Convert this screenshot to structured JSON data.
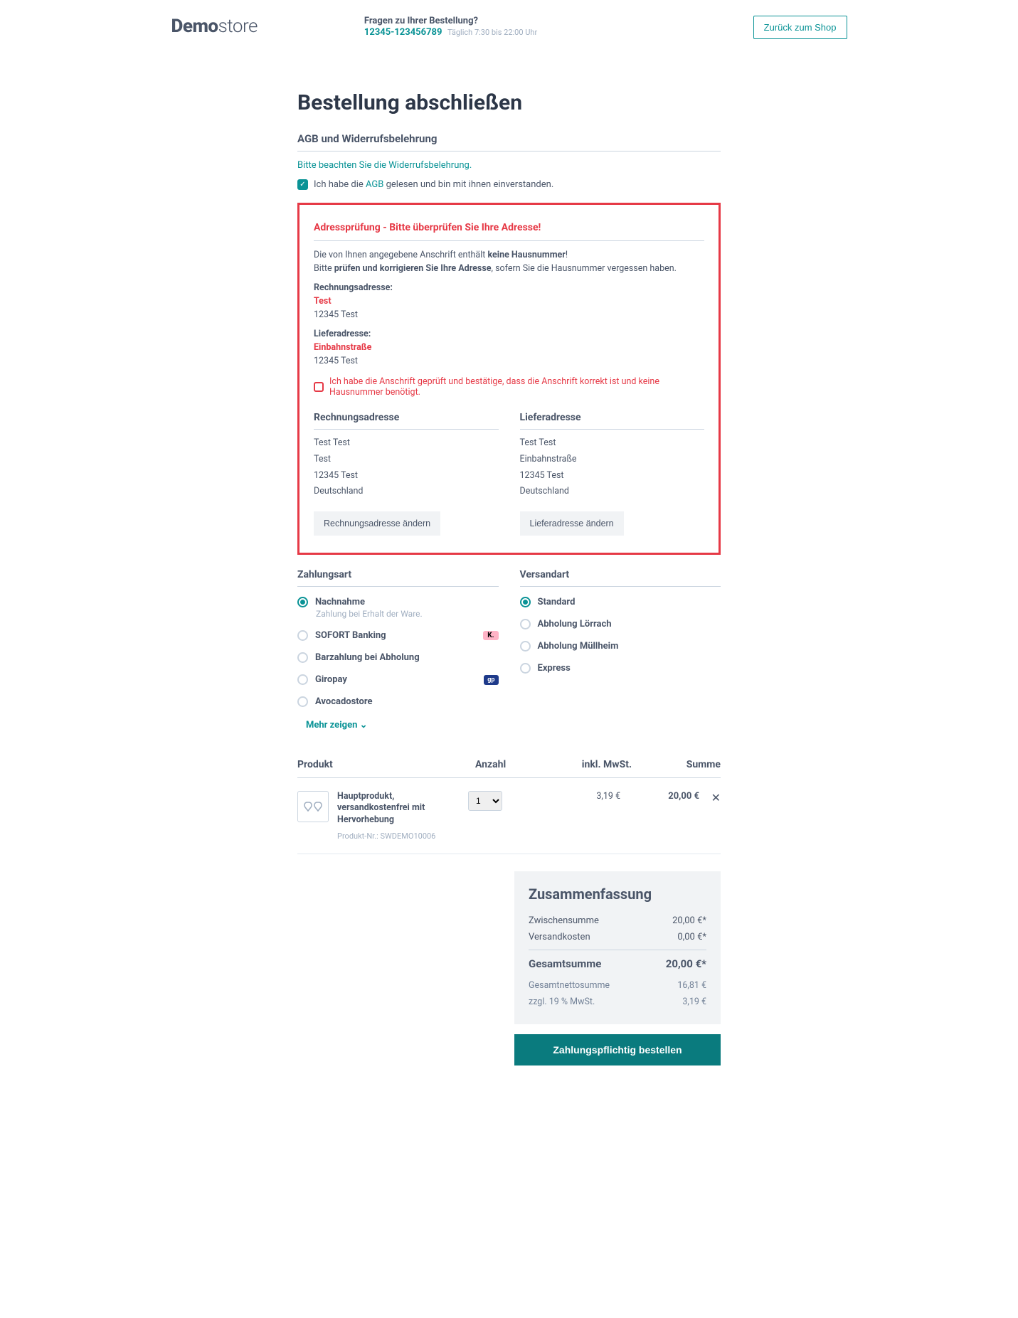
{
  "header": {
    "logo_bold": "Demo",
    "logo_light": "store",
    "question": "Fragen zu Ihrer Bestellung?",
    "phone": "12345-123456789",
    "hours": "Täglich 7:30 bis 22:00 Uhr",
    "back": "Zurück zum Shop"
  },
  "title": "Bestellung abschließen",
  "terms": {
    "heading": "AGB und Widerrufsbelehrung",
    "notice": "Bitte beachten Sie die Widerrufsbelehrung.",
    "accept_pre": "Ich habe die ",
    "accept_link": "AGB",
    "accept_post": " gelesen und bin mit ihnen einverstanden."
  },
  "address_check": {
    "title": "Adressprüfung - Bitte überprüfen Sie Ihre Adresse!",
    "line1a": "Die von Ihnen angegebene Anschrift enthält ",
    "line1b": "keine Hausnummer",
    "line1c": "!",
    "line2a": "Bitte ",
    "line2b": "prüfen und korrigieren Sie Ihre Adresse",
    "line2c": ", sofern Sie die Hausnummer vergessen haben.",
    "billing_label": "Rechnungsadresse:",
    "billing_street": "Test",
    "billing_city": "12345 Test",
    "shipping_label": "Lieferadresse:",
    "shipping_street": "Einbahnstraße",
    "shipping_city": "12345 Test",
    "confirm": "Ich habe die Anschrift geprüft und bestätige, dass die Anschrift korrekt ist und keine Hausnummer benötigt."
  },
  "billing": {
    "heading": "Rechnungsadresse",
    "name": "Test Test",
    "street": "Test",
    "city": "12345 Test",
    "country": "Deutschland",
    "change": "Rechnungsadresse ändern"
  },
  "shipping": {
    "heading": "Lieferadresse",
    "name": "Test Test",
    "street": "Einbahnstraße",
    "city": "12345 Test",
    "country": "Deutschland",
    "change": "Lieferadresse ändern"
  },
  "payment": {
    "heading": "Zahlungsart",
    "options": [
      {
        "label": "Nachnahme",
        "sub": "Zahlung bei Erhalt der Ware.",
        "selected": true
      },
      {
        "label": "SOFORT Banking",
        "badge": "K."
      },
      {
        "label": "Barzahlung bei Abholung"
      },
      {
        "label": "Giropay",
        "badge_blue": "gp"
      },
      {
        "label": "Avocadostore"
      }
    ],
    "show_more": "Mehr zeigen"
  },
  "shipmethod": {
    "heading": "Versandart",
    "options": [
      {
        "label": "Standard",
        "selected": true
      },
      {
        "label": "Abholung Lörrach"
      },
      {
        "label": "Abholung Müllheim"
      },
      {
        "label": "Express"
      }
    ]
  },
  "cart": {
    "h_product": "Produkt",
    "h_qty": "Anzahl",
    "h_tax": "inkl. MwSt.",
    "h_sum": "Summe",
    "product_name": "Hauptprodukt, versandkostenfrei mit Hervorhebung",
    "sku": "Produkt-Nr.: SWDEMO10006",
    "qty": "1",
    "tax": "3,19 €",
    "sum": "20,00 €"
  },
  "summary": {
    "heading": "Zusammenfassung",
    "subtotal_label": "Zwischensumme",
    "subtotal": "20,00 €*",
    "shipping_label": "Versandkosten",
    "shipping": "0,00 €*",
    "total_label": "Gesamtsumme",
    "total": "20,00 €*",
    "net_label": "Gesamtnettosumme",
    "net": "16,81 €",
    "vat_label": "zzgl. 19 % MwSt.",
    "vat": "3,19 €"
  },
  "order_button": "Zahlungspflichtig bestellen"
}
